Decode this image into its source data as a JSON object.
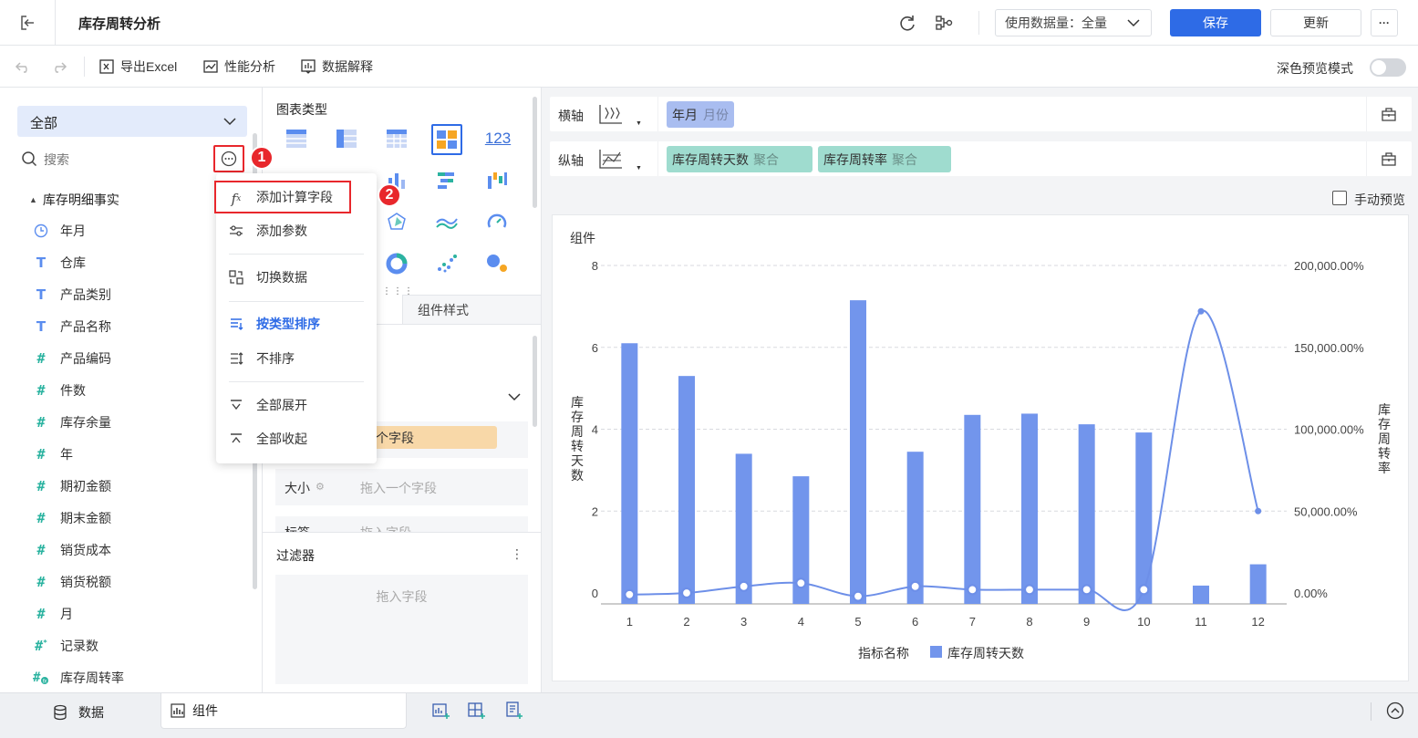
{
  "header": {
    "title": "库存周转分析",
    "data_volume_label": "使用数据量：全量",
    "save_label": "保存",
    "update_label": "更新",
    "more_label": "···"
  },
  "toolbar": {
    "export_excel": "导出Excel",
    "performance": "性能分析",
    "data_explain": "数据解释",
    "dark_preview": "深色预览模式"
  },
  "left": {
    "scope": "全部",
    "search_placeholder": "搜索",
    "table_name": "库存明细事实",
    "fields": [
      {
        "label": "年月",
        "icon": "clock-icon"
      },
      {
        "label": "仓库",
        "icon": "text-icon"
      },
      {
        "label": "产品类别",
        "icon": "text-icon"
      },
      {
        "label": "产品名称",
        "icon": "text-icon"
      },
      {
        "label": "产品编码",
        "icon": "hash-icon"
      },
      {
        "label": "件数",
        "icon": "hash-icon"
      },
      {
        "label": "库存余量",
        "icon": "hash-icon"
      },
      {
        "label": "年",
        "icon": "hash-icon"
      },
      {
        "label": "期初金额",
        "icon": "hash-icon"
      },
      {
        "label": "期末金额",
        "icon": "hash-icon"
      },
      {
        "label": "销货成本",
        "icon": "hash-icon"
      },
      {
        "label": "销货税额",
        "icon": "hash-icon"
      },
      {
        "label": "月",
        "icon": "hash-icon"
      },
      {
        "label": "记录数",
        "icon": "hash-star-icon"
      },
      {
        "label": "库存周转率",
        "icon": "calc-field-icon"
      }
    ]
  },
  "menu": {
    "items": [
      {
        "label": "添加计算字段",
        "icon": "fx-icon"
      },
      {
        "label": "添加参数",
        "icon": "slider-icon"
      },
      {
        "label": "切换数据",
        "icon": "switch-data-icon"
      },
      {
        "label": "按类型排序",
        "icon": "sort-type-icon"
      },
      {
        "label": "不排序",
        "icon": "no-sort-icon"
      },
      {
        "label": "全部展开",
        "icon": "expand-all-icon"
      },
      {
        "label": "全部收起",
        "icon": "collapse-all-icon"
      }
    ],
    "badge1": "1",
    "badge2": "2"
  },
  "middle": {
    "chart_type_title": "图表类型",
    "number_icon_label": "123",
    "tab_component_style": "组件样式",
    "color_field_fragment": "个字段",
    "size_label": "大小",
    "size_placeholder": "拖入一个字段",
    "label_fragment": "标签",
    "label_placeholder_fragment": "拖入字段",
    "filter_title": "过滤器",
    "filter_placeholder": "拖入字段"
  },
  "axes": {
    "x_label": "横轴",
    "y_label": "纵轴",
    "x_fields": [
      {
        "name": "年月",
        "agg": "月份"
      }
    ],
    "y_fields": [
      {
        "name": "库存周转天数",
        "agg": "聚合"
      },
      {
        "name": "库存周转率",
        "agg": "聚合"
      }
    ],
    "manual_preview": "手动预览"
  },
  "chart_panel": {
    "title": "组件"
  },
  "bottom": {
    "data_tab": "数据",
    "component_tab": "组件"
  },
  "colors": {
    "primary": "#2e6be6",
    "bar": "#7295ec",
    "badge": "#e8272c",
    "x_pill": "#a9bdf0",
    "y_pill": "#9fdccf"
  },
  "chart_data": {
    "type": "bar",
    "title": "组件",
    "categories": [
      "1",
      "2",
      "3",
      "4",
      "5",
      "6",
      "7",
      "8",
      "9",
      "10",
      "11",
      "12"
    ],
    "x_title": "指标名称",
    "y_left_label": "库存周转天数",
    "y_right_label": "库存周转率",
    "y_left_ticks": [
      "0",
      "2",
      "4",
      "6",
      "8"
    ],
    "y_right_ticks": [
      "0.00%",
      "50,000.00%",
      "100,000.00%",
      "150,000.00%",
      "200,000.00%"
    ],
    "ylim_left": [
      0,
      8
    ],
    "ylim_right": [
      0,
      200000
    ],
    "series": [
      {
        "name": "库存周转天数",
        "type": "bar",
        "axis": "left",
        "values": [
          6.1,
          5.3,
          3.4,
          2.85,
          7.15,
          3.45,
          4.35,
          4.38,
          4.12,
          3.92,
          0.18,
          0.7
        ]
      },
      {
        "type": "line",
        "axis": "right",
        "values": [
          -1000,
          0,
          4000,
          6000,
          -2000,
          4000,
          2000,
          2000,
          2000,
          2000,
          172000,
          50000
        ]
      }
    ],
    "legend": [
      "指标名称",
      "库存周转天数"
    ],
    "legend_position": "bottom",
    "grid": true
  }
}
